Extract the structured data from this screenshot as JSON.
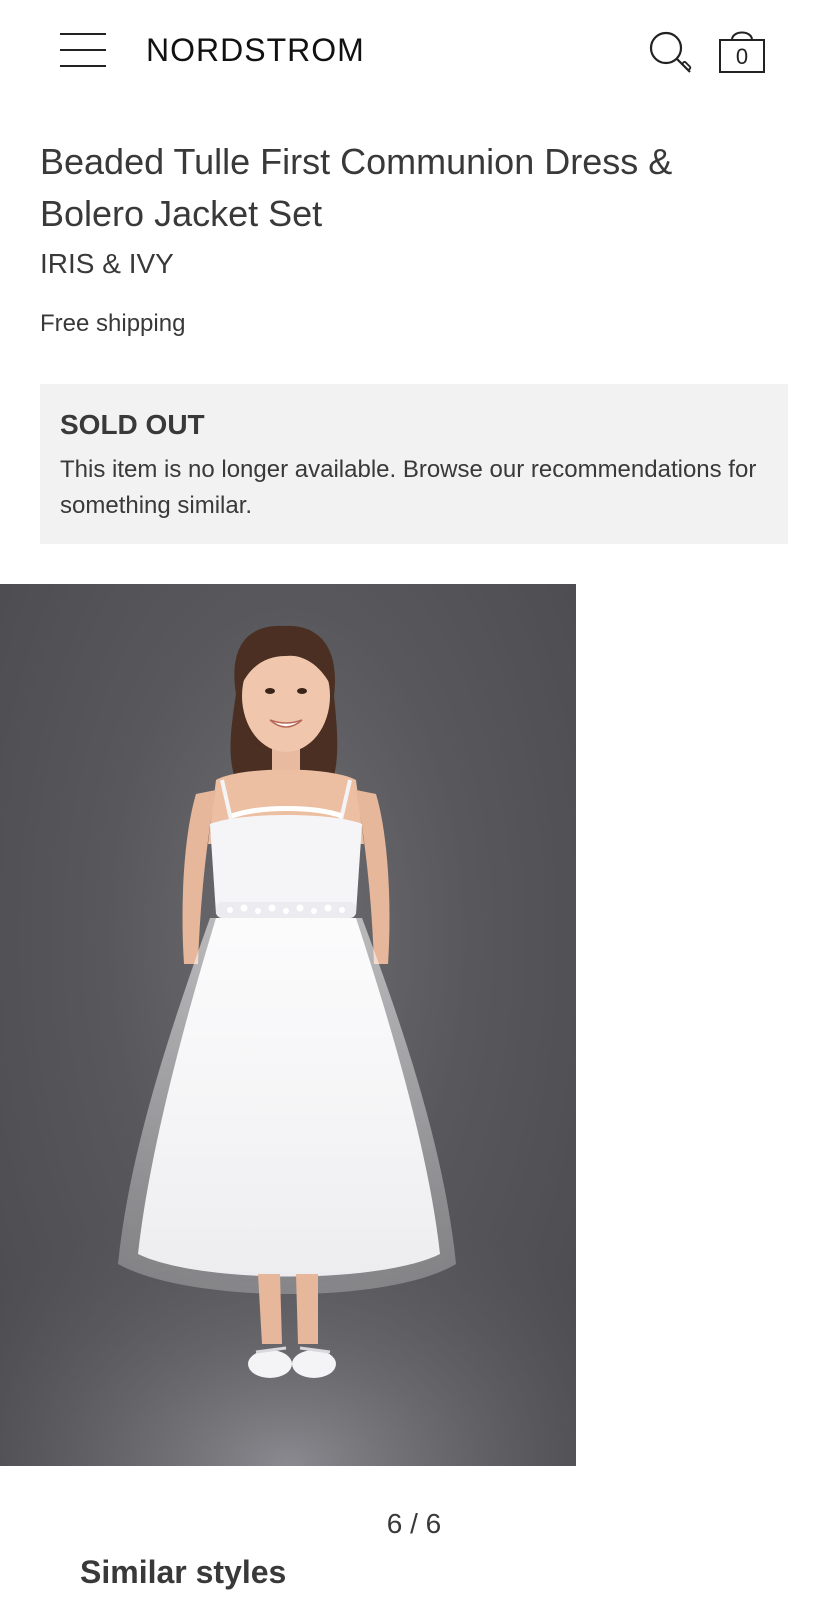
{
  "header": {
    "logo_text": "NORDSTROM",
    "bag_count": "0"
  },
  "product": {
    "title": "Beaded Tulle First Communion Dress & Bolero Jacket Set",
    "brand": "IRIS & IVY",
    "shipping": "Free shipping",
    "image_alt": "Beaded Tulle First Communion Dress & Bolero Jacket Set"
  },
  "availability": {
    "heading": "SOLD OUT",
    "message": "This item is no longer available. Browse our recommendations for something similar."
  },
  "gallery": {
    "pager": "6 / 6"
  },
  "recommendations": {
    "heading": "Similar styles"
  },
  "icons": {
    "menu": "hamburger-menu-icon",
    "search": "search-icon",
    "bag": "shopping-bag-icon"
  }
}
